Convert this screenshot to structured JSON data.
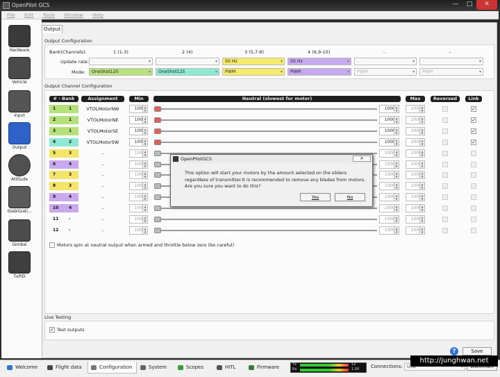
{
  "window": {
    "title": "OpenPilot GCS",
    "minimize": "—",
    "maximize": "□",
    "close": "✕"
  },
  "menu": [
    "File",
    "Edit",
    "Tools",
    "Window",
    "Help"
  ],
  "sidebar": [
    "Hardware",
    "Vehicle",
    "Input",
    "Output",
    "Attitude",
    "Stabilizati...",
    "Gimbal",
    "TxPID"
  ],
  "tab": "Output",
  "output_config": {
    "title": "Output Configuration",
    "bank_label": "Bank(Channels):",
    "update_label": "Update rate:",
    "mode_label": "Mode:",
    "banks": [
      "1 (1-3)",
      "2 (4)",
      "3 (5,7-8)",
      "4 (6,9-10)",
      "-",
      "-"
    ],
    "update_rates": [
      "-",
      "-",
      "50 Hz",
      "50 Hz",
      "-",
      "-"
    ],
    "modes": [
      "OneShot125",
      "OneShot125",
      "PWM",
      "PWM",
      "PWM",
      "PWM"
    ]
  },
  "channel_config": {
    "title": "Output Channel Configuration",
    "headers": {
      "bank": "# - Bank",
      "assignment": "Assignment",
      "min": "Min",
      "neutral": "Neutral (slowest for motor)",
      "max": "Max",
      "reversed": "Reversed",
      "link": "Link"
    },
    "rows": [
      {
        "num": "1",
        "bank": "1",
        "assignment": "VTOLMotorNW",
        "min": "1000",
        "neutral": "1000",
        "max": "2000",
        "link": "✓",
        "color": "#b6e07a",
        "active": true
      },
      {
        "num": "2",
        "bank": "1",
        "assignment": "VTOLMotorNE",
        "min": "1000",
        "neutral": "1000",
        "max": "2000",
        "link": "✓",
        "color": "#b6e07a",
        "active": true
      },
      {
        "num": "3",
        "bank": "1",
        "assignment": "VTOLMotorSE",
        "min": "1000",
        "neutral": "1000",
        "max": "2000",
        "link": "✓",
        "color": "#b6e07a",
        "active": true
      },
      {
        "num": "4",
        "bank": "2",
        "assignment": "VTOLMotorSW",
        "min": "1000",
        "neutral": "1000",
        "max": "2000",
        "link": "✓",
        "color": "#8ee8d4",
        "active": true
      },
      {
        "num": "5",
        "bank": "3",
        "assignment": "-",
        "min": "1000",
        "neutral": "1000",
        "max": "1000",
        "link": "",
        "color": "#f5e46a",
        "active": false
      },
      {
        "num": "6",
        "bank": "4",
        "assignment": "-",
        "min": "1000",
        "neutral": "1000",
        "max": "1000",
        "link": "",
        "color": "#c9a8ee",
        "active": false
      },
      {
        "num": "7",
        "bank": "3",
        "assignment": "-",
        "min": "1000",
        "neutral": "1000",
        "max": "1000",
        "link": "",
        "color": "#f5e46a",
        "active": false
      },
      {
        "num": "8",
        "bank": "3",
        "assignment": "-",
        "min": "1000",
        "neutral": "1000",
        "max": "1000",
        "link": "",
        "color": "#f5e46a",
        "active": false
      },
      {
        "num": "9",
        "bank": "4",
        "assignment": "-",
        "min": "1000",
        "neutral": "1000",
        "max": "1000",
        "link": "",
        "color": "#c9a8ee",
        "active": false
      },
      {
        "num": "10",
        "bank": "4",
        "assignment": "-",
        "min": "1000",
        "neutral": "1000",
        "max": "1000",
        "link": "",
        "color": "#c9a8ee",
        "active": false
      },
      {
        "num": "11",
        "bank": "-",
        "assignment": "-",
        "min": "1000",
        "neutral": "1000",
        "max": "1000",
        "link": "",
        "color": "",
        "active": false
      },
      {
        "num": "12",
        "bank": "-",
        "assignment": "-",
        "min": "1000",
        "neutral": "1000",
        "max": "1000",
        "link": "",
        "color": "",
        "active": false
      }
    ],
    "spin_note": "Motors spin at neutral output when armed and throttle below zero (be careful)"
  },
  "live_testing": {
    "title": "Live Testing",
    "test_outputs": "Test outputs",
    "checked": "✓"
  },
  "save": "Save",
  "help": "?",
  "dialog": {
    "title": "OpenPilotGCS",
    "message": "This option will start your motors by the amount selected on the sliders regardless of transmitter.It is recommended to remove any blades from motors. Are you sure you want to do this?",
    "yes": "Yes",
    "no": "No",
    "close": "✕"
  },
  "bottom_tabs": [
    "Welcome",
    "Flight data",
    "Configuration",
    "System",
    "Scopes",
    "HITL",
    "Firmware"
  ],
  "status": {
    "tx": "Tx",
    "rx": "Rx",
    "tx_val": "12",
    "rx_val": "1.00",
    "connections": "Connections:",
    "disconnect": "Disconnect",
    "port": "USB"
  },
  "watermark": "http://junghwan.net",
  "colors": {
    "bank1": "#b6e07a",
    "bank2": "#8ee8d4",
    "bank3": "#f5e46a",
    "bank4": "#c9a8ee",
    "slider_on": "#e06060"
  }
}
